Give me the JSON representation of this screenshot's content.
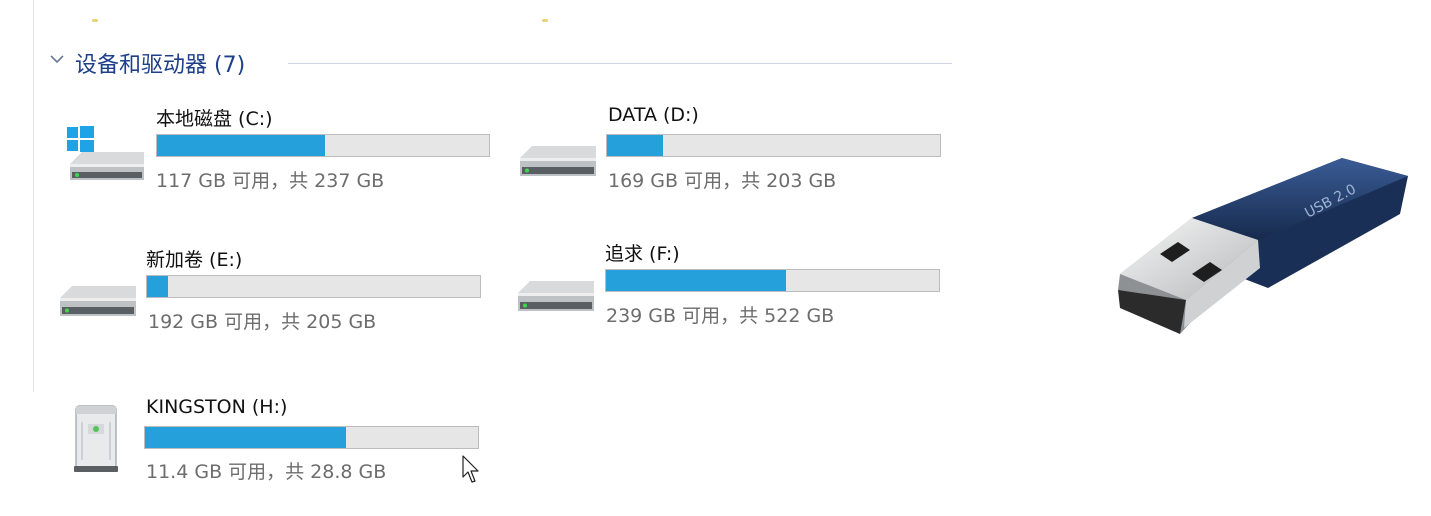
{
  "group": {
    "title": "设备和驱动器 (7)"
  },
  "drives": [
    {
      "name": "本地磁盘 (C:)",
      "free_text": "117 GB 可用，共 237 GB",
      "used_fraction": 0.506,
      "icon": "windows-drive-icon"
    },
    {
      "name": "DATA (D:)",
      "free_text": "169 GB 可用，共 203 GB",
      "used_fraction": 0.167,
      "icon": "hard-drive-icon"
    },
    {
      "name": "新加卷 (E:)",
      "free_text": "192 GB 可用，共 205 GB",
      "used_fraction": 0.063,
      "icon": "hard-drive-icon"
    },
    {
      "name": "追求 (F:)",
      "free_text": "239 GB 可用，共 522 GB",
      "used_fraction": 0.542,
      "icon": "hard-drive-icon"
    },
    {
      "name": "KINGSTON (H:)",
      "free_text": "11.4 GB 可用，共 28.8 GB",
      "used_fraction": 0.604,
      "icon": "removable-drive-icon"
    }
  ],
  "usb_stick": {
    "label": "USB 2.0",
    "body_color": "#24406e"
  },
  "colors": {
    "accent": "#26a0da",
    "bar_background": "#e6e6e6",
    "group_title": "#1e3f8a"
  }
}
